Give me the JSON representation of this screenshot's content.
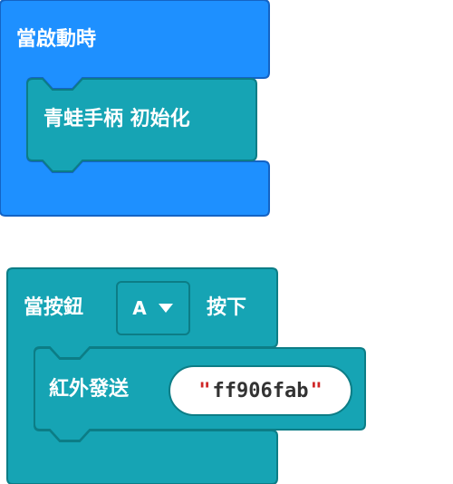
{
  "colors": {
    "basic_block": "#1e90ff",
    "basic_block_border": "#1463c4",
    "frog_block": "#16a4b4",
    "frog_block_border": "#0c7d86",
    "string_text": "#333333",
    "string_quote": "#cf2727"
  },
  "block_on_start": {
    "label": "當啟動時",
    "inner_block": {
      "label": "青蛙手柄 初始化"
    }
  },
  "block_on_button": {
    "label_prefix": "當按鈕",
    "button_option": "A",
    "dropdown_icon": "triangle-down-icon",
    "label_suffix": "按下",
    "inner_block": {
      "label": "紅外發送",
      "string_value": "ff906fab",
      "quote_open": "\"",
      "quote_close": "\""
    }
  }
}
